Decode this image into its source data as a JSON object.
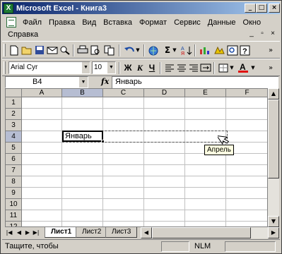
{
  "window": {
    "title": "Microsoft Excel - Книга3",
    "app_icon": "excel-icon",
    "buttons": [
      "minimize",
      "maximize",
      "close"
    ]
  },
  "menu": {
    "items": [
      "Файл",
      "Правка",
      "Вид",
      "Вставка",
      "Формат",
      "Сервис",
      "Данные",
      "Окно"
    ],
    "row2_items": [
      "Справка"
    ]
  },
  "toolbar": {
    "font_name": "Arial Cyr",
    "font_size": "10",
    "bold": "Ж",
    "italic": "К",
    "underline": "Ч"
  },
  "formula_bar": {
    "name_box": "B4",
    "fx": "fx",
    "content": "Январь"
  },
  "grid": {
    "columns": [
      "A",
      "B",
      "C",
      "D",
      "E",
      "F"
    ],
    "selected_column": "B",
    "rows": [
      "1",
      "2",
      "3",
      "4",
      "5",
      "6",
      "7",
      "8",
      "9",
      "10",
      "11",
      "12"
    ],
    "selected_row": "4",
    "active_cell_value": "Январь",
    "drag_tooltip": "Апрель"
  },
  "sheets": {
    "tabs": [
      "Лист1",
      "Лист2",
      "Лист3"
    ],
    "active": "Лист1"
  },
  "status": {
    "text": "Тащите, чтобы",
    "indicator": "NLM"
  }
}
